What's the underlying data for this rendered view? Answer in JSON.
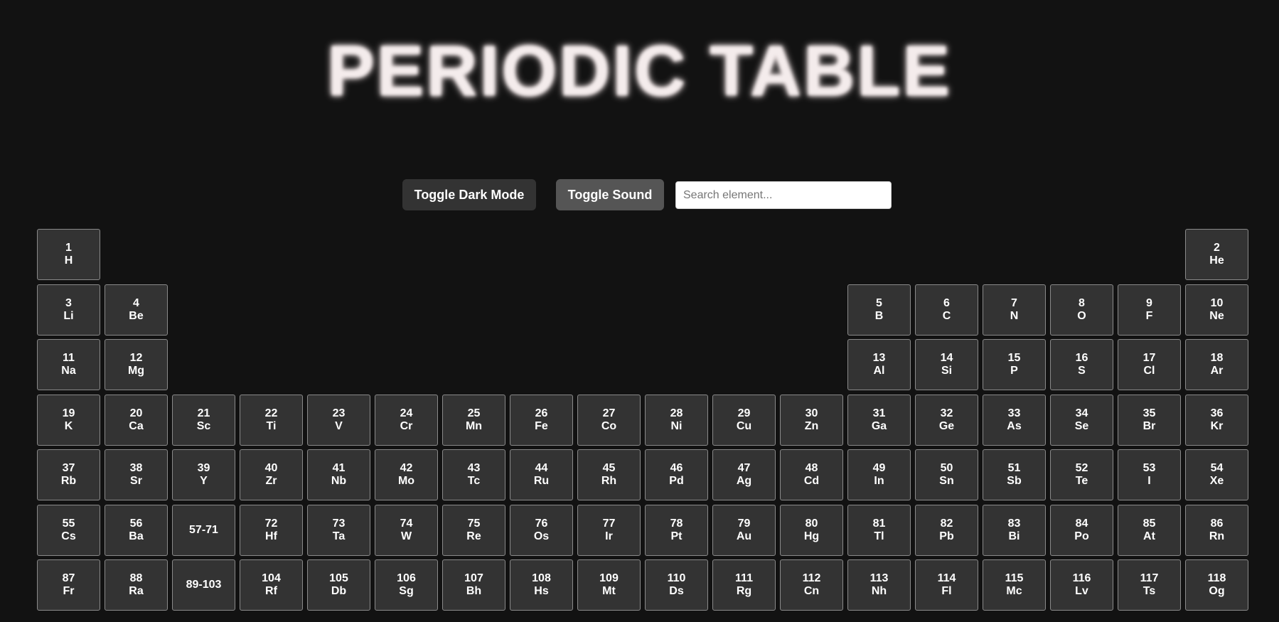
{
  "title": "PERIODIC TABLE",
  "controls": {
    "dark_mode_label": "Toggle Dark Mode",
    "sound_label": "Toggle Sound",
    "search_placeholder": "Search element..."
  },
  "elements": [
    {
      "number": "1",
      "symbol": "H",
      "row": 1,
      "col": 1
    },
    {
      "number": "2",
      "symbol": "He",
      "row": 1,
      "col": 18
    },
    {
      "number": "3",
      "symbol": "Li",
      "row": 2,
      "col": 1
    },
    {
      "number": "4",
      "symbol": "Be",
      "row": 2,
      "col": 2
    },
    {
      "number": "5",
      "symbol": "B",
      "row": 2,
      "col": 13
    },
    {
      "number": "6",
      "symbol": "C",
      "row": 2,
      "col": 14
    },
    {
      "number": "7",
      "symbol": "N",
      "row": 2,
      "col": 15
    },
    {
      "number": "8",
      "symbol": "O",
      "row": 2,
      "col": 16
    },
    {
      "number": "9",
      "symbol": "F",
      "row": 2,
      "col": 17
    },
    {
      "number": "10",
      "symbol": "Ne",
      "row": 2,
      "col": 18
    },
    {
      "number": "11",
      "symbol": "Na",
      "row": 3,
      "col": 1
    },
    {
      "number": "12",
      "symbol": "Mg",
      "row": 3,
      "col": 2
    },
    {
      "number": "13",
      "symbol": "Al",
      "row": 3,
      "col": 13
    },
    {
      "number": "14",
      "symbol": "Si",
      "row": 3,
      "col": 14
    },
    {
      "number": "15",
      "symbol": "P",
      "row": 3,
      "col": 15
    },
    {
      "number": "16",
      "symbol": "S",
      "row": 3,
      "col": 16
    },
    {
      "number": "17",
      "symbol": "Cl",
      "row": 3,
      "col": 17
    },
    {
      "number": "18",
      "symbol": "Ar",
      "row": 3,
      "col": 18
    },
    {
      "number": "19",
      "symbol": "K",
      "row": 4,
      "col": 1
    },
    {
      "number": "20",
      "symbol": "Ca",
      "row": 4,
      "col": 2
    },
    {
      "number": "21",
      "symbol": "Sc",
      "row": 4,
      "col": 3
    },
    {
      "number": "22",
      "symbol": "Ti",
      "row": 4,
      "col": 4
    },
    {
      "number": "23",
      "symbol": "V",
      "row": 4,
      "col": 5
    },
    {
      "number": "24",
      "symbol": "Cr",
      "row": 4,
      "col": 6
    },
    {
      "number": "25",
      "symbol": "Mn",
      "row": 4,
      "col": 7
    },
    {
      "number": "26",
      "symbol": "Fe",
      "row": 4,
      "col": 8
    },
    {
      "number": "27",
      "symbol": "Co",
      "row": 4,
      "col": 9
    },
    {
      "number": "28",
      "symbol": "Ni",
      "row": 4,
      "col": 10
    },
    {
      "number": "29",
      "symbol": "Cu",
      "row": 4,
      "col": 11
    },
    {
      "number": "30",
      "symbol": "Zn",
      "row": 4,
      "col": 12
    },
    {
      "number": "31",
      "symbol": "Ga",
      "row": 4,
      "col": 13
    },
    {
      "number": "32",
      "symbol": "Ge",
      "row": 4,
      "col": 14
    },
    {
      "number": "33",
      "symbol": "As",
      "row": 4,
      "col": 15
    },
    {
      "number": "34",
      "symbol": "Se",
      "row": 4,
      "col": 16
    },
    {
      "number": "35",
      "symbol": "Br",
      "row": 4,
      "col": 17
    },
    {
      "number": "36",
      "symbol": "Kr",
      "row": 4,
      "col": 18
    },
    {
      "number": "37",
      "symbol": "Rb",
      "row": 5,
      "col": 1
    },
    {
      "number": "38",
      "symbol": "Sr",
      "row": 5,
      "col": 2
    },
    {
      "number": "39",
      "symbol": "Y",
      "row": 5,
      "col": 3
    },
    {
      "number": "40",
      "symbol": "Zr",
      "row": 5,
      "col": 4
    },
    {
      "number": "41",
      "symbol": "Nb",
      "row": 5,
      "col": 5
    },
    {
      "number": "42",
      "symbol": "Mo",
      "row": 5,
      "col": 6
    },
    {
      "number": "43",
      "symbol": "Tc",
      "row": 5,
      "col": 7
    },
    {
      "number": "44",
      "symbol": "Ru",
      "row": 5,
      "col": 8
    },
    {
      "number": "45",
      "symbol": "Rh",
      "row": 5,
      "col": 9
    },
    {
      "number": "46",
      "symbol": "Pd",
      "row": 5,
      "col": 10
    },
    {
      "number": "47",
      "symbol": "Ag",
      "row": 5,
      "col": 11
    },
    {
      "number": "48",
      "symbol": "Cd",
      "row": 5,
      "col": 12
    },
    {
      "number": "49",
      "symbol": "In",
      "row": 5,
      "col": 13
    },
    {
      "number": "50",
      "symbol": "Sn",
      "row": 5,
      "col": 14
    },
    {
      "number": "51",
      "symbol": "Sb",
      "row": 5,
      "col": 15
    },
    {
      "number": "52",
      "symbol": "Te",
      "row": 5,
      "col": 16
    },
    {
      "number": "53",
      "symbol": "I",
      "row": 5,
      "col": 17
    },
    {
      "number": "54",
      "symbol": "Xe",
      "row": 5,
      "col": 18
    },
    {
      "number": "55",
      "symbol": "Cs",
      "row": 6,
      "col": 1
    },
    {
      "number": "56",
      "symbol": "Ba",
      "row": 6,
      "col": 2
    },
    {
      "number": "57-71",
      "symbol": "",
      "row": 6,
      "col": 3
    },
    {
      "number": "72",
      "symbol": "Hf",
      "row": 6,
      "col": 4
    },
    {
      "number": "73",
      "symbol": "Ta",
      "row": 6,
      "col": 5
    },
    {
      "number": "74",
      "symbol": "W",
      "row": 6,
      "col": 6
    },
    {
      "number": "75",
      "symbol": "Re",
      "row": 6,
      "col": 7
    },
    {
      "number": "76",
      "symbol": "Os",
      "row": 6,
      "col": 8
    },
    {
      "number": "77",
      "symbol": "Ir",
      "row": 6,
      "col": 9
    },
    {
      "number": "78",
      "symbol": "Pt",
      "row": 6,
      "col": 10
    },
    {
      "number": "79",
      "symbol": "Au",
      "row": 6,
      "col": 11
    },
    {
      "number": "80",
      "symbol": "Hg",
      "row": 6,
      "col": 12
    },
    {
      "number": "81",
      "symbol": "Tl",
      "row": 6,
      "col": 13
    },
    {
      "number": "82",
      "symbol": "Pb",
      "row": 6,
      "col": 14
    },
    {
      "number": "83",
      "symbol": "Bi",
      "row": 6,
      "col": 15
    },
    {
      "number": "84",
      "symbol": "Po",
      "row": 6,
      "col": 16
    },
    {
      "number": "85",
      "symbol": "At",
      "row": 6,
      "col": 17
    },
    {
      "number": "86",
      "symbol": "Rn",
      "row": 6,
      "col": 18
    },
    {
      "number": "87",
      "symbol": "Fr",
      "row": 7,
      "col": 1
    },
    {
      "number": "88",
      "symbol": "Ra",
      "row": 7,
      "col": 2
    },
    {
      "number": "89-103",
      "symbol": "",
      "row": 7,
      "col": 3
    },
    {
      "number": "104",
      "symbol": "Rf",
      "row": 7,
      "col": 4
    },
    {
      "number": "105",
      "symbol": "Db",
      "row": 7,
      "col": 5
    },
    {
      "number": "106",
      "symbol": "Sg",
      "row": 7,
      "col": 6
    },
    {
      "number": "107",
      "symbol": "Bh",
      "row": 7,
      "col": 7
    },
    {
      "number": "108",
      "symbol": "Hs",
      "row": 7,
      "col": 8
    },
    {
      "number": "109",
      "symbol": "Mt",
      "row": 7,
      "col": 9
    },
    {
      "number": "110",
      "symbol": "Ds",
      "row": 7,
      "col": 10
    },
    {
      "number": "111",
      "symbol": "Rg",
      "row": 7,
      "col": 11
    },
    {
      "number": "112",
      "symbol": "Cn",
      "row": 7,
      "col": 12
    },
    {
      "number": "113",
      "symbol": "Nh",
      "row": 7,
      "col": 13
    },
    {
      "number": "114",
      "symbol": "Fl",
      "row": 7,
      "col": 14
    },
    {
      "number": "115",
      "symbol": "Mc",
      "row": 7,
      "col": 15
    },
    {
      "number": "116",
      "symbol": "Lv",
      "row": 7,
      "col": 16
    },
    {
      "number": "117",
      "symbol": "Ts",
      "row": 7,
      "col": 17
    },
    {
      "number": "118",
      "symbol": "Og",
      "row": 7,
      "col": 18
    }
  ]
}
